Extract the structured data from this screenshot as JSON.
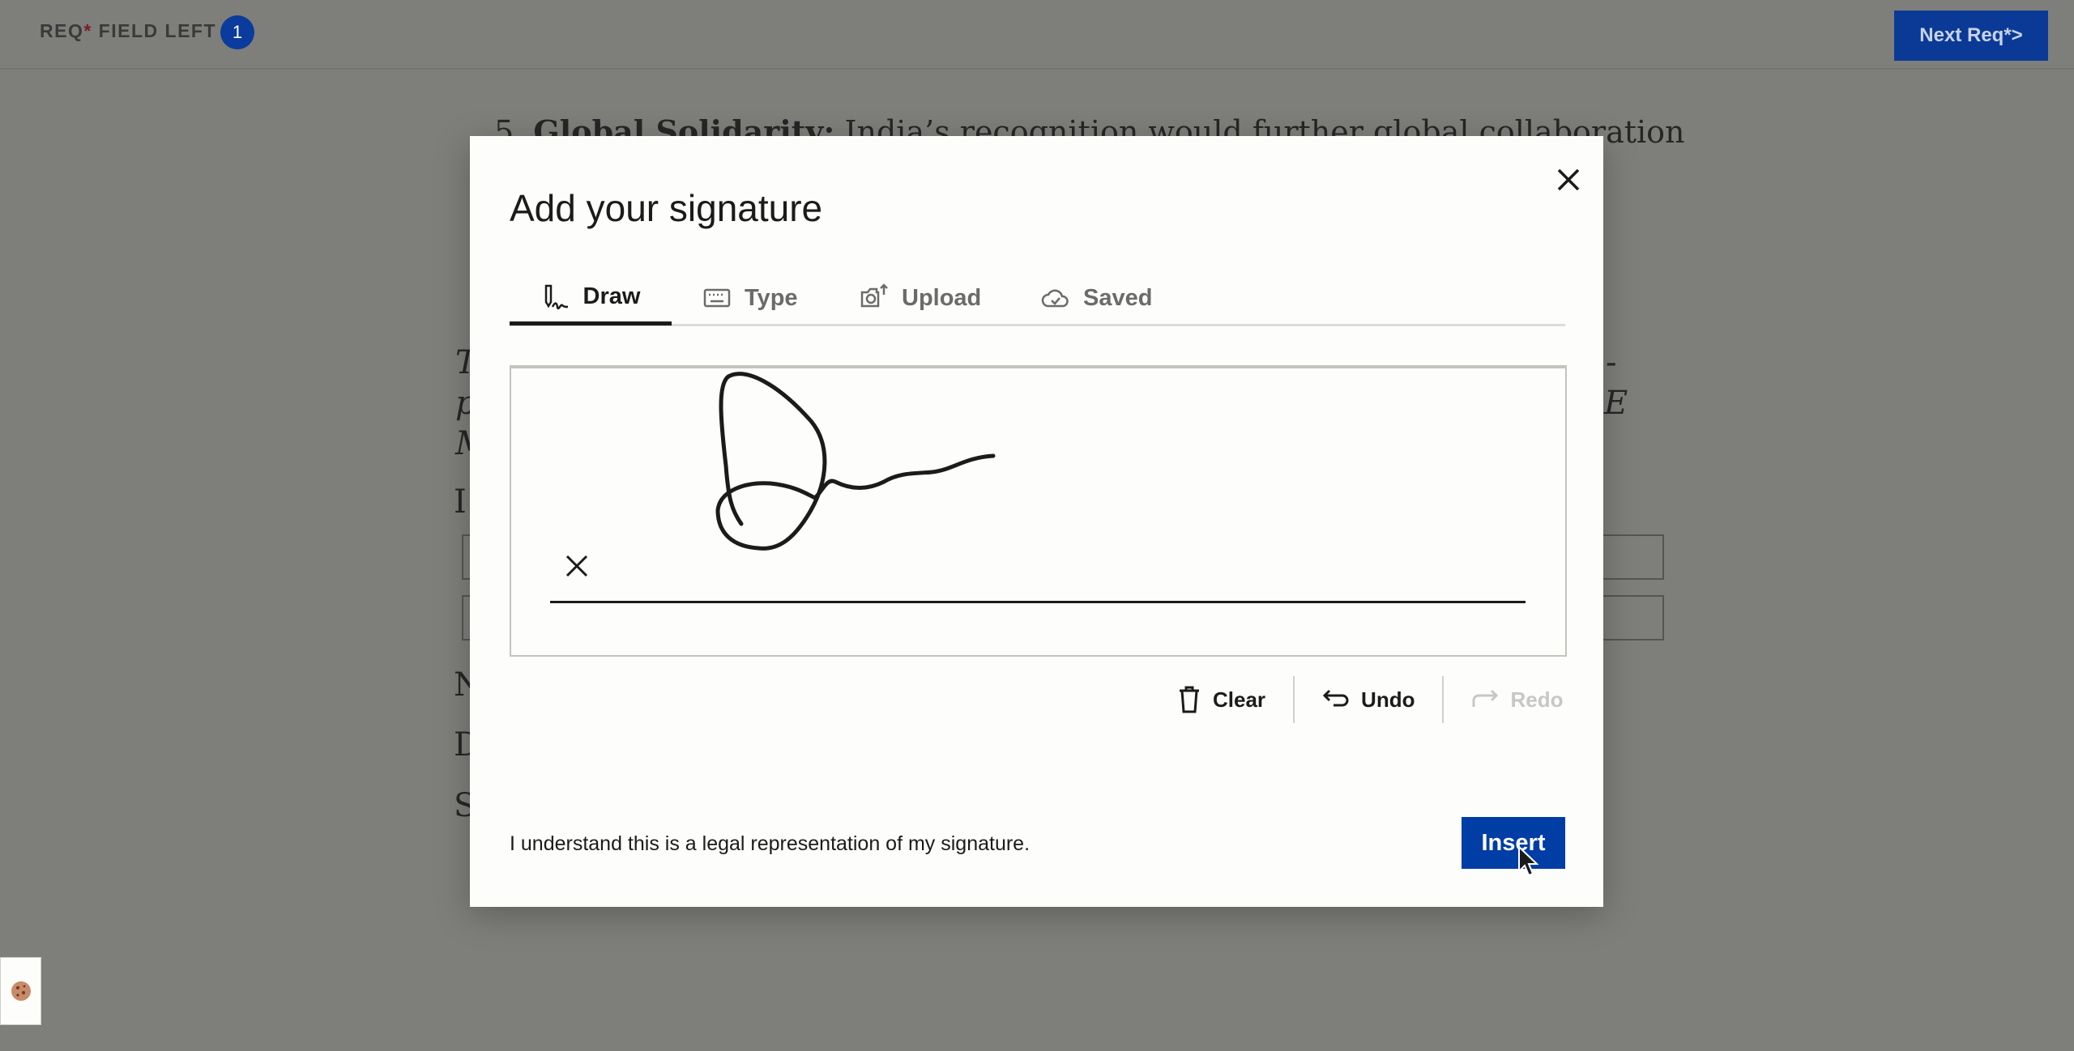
{
  "topbar": {
    "req_prefix": "REQ",
    "req_star": "*",
    "req_suffix": " FIELD LEFT",
    "req_count": "1",
    "next_label": "Next Req*>"
  },
  "document": {
    "line_number": "5.",
    "line_bold": "Global Solidarity:",
    "line_text": " India’s recognition would further global collaboration",
    "fragments_left": [
      "T",
      "p",
      "M",
      "I",
      "N",
      "D",
      "S"
    ],
    "fragments_right": [
      "-",
      "E"
    ]
  },
  "modal": {
    "title": "Add your signature",
    "tabs": [
      {
        "label": "Draw",
        "icon": "pen-signature-icon",
        "active": true
      },
      {
        "label": "Type",
        "icon": "keyboard-icon",
        "active": false
      },
      {
        "label": "Upload",
        "icon": "camera-upload-icon",
        "active": false
      },
      {
        "label": "Saved",
        "icon": "cloud-check-icon",
        "active": false
      }
    ],
    "signature_marker": "X",
    "actions": {
      "clear": "Clear",
      "undo": "Undo",
      "redo": "Redo"
    },
    "consent": "I understand this is a legal representation of my signature.",
    "insert_label": "Insert"
  },
  "colors": {
    "primary": "#003da5",
    "overlay": "#7e7f7a",
    "modal_bg": "#fdfdfb"
  }
}
